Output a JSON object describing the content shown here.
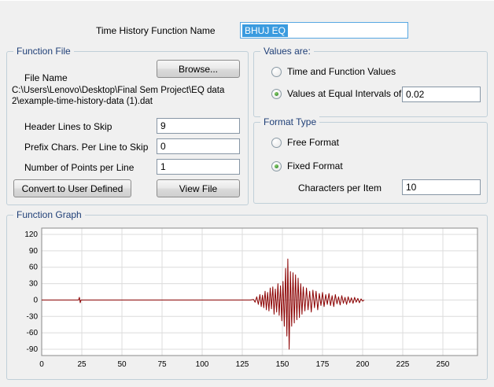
{
  "header": {
    "name_label": "Time History Function Name",
    "name_value": "BHUJ EQ"
  },
  "colors": {
    "selection": "#3a9bdf",
    "group_title": "#1f3f77"
  },
  "function_file": {
    "title": "Function File",
    "file_name_label": "File Name",
    "browse_button": "Browse...",
    "file_path_line1": "C:\\Users\\Lenovo\\Desktop\\Final Sem Project\\EQ data",
    "file_path_line2": "2\\example-time-history-data (1).dat",
    "header_lines_label": "Header Lines to Skip",
    "header_lines_value": "9",
    "prefix_chars_label": "Prefix Chars. Per Line to Skip",
    "prefix_chars_value": "0",
    "points_per_line_label": "Number of Points per Line",
    "points_per_line_value": "1",
    "convert_button": "Convert to User Defined",
    "view_file_button": "View File"
  },
  "values_are": {
    "title": "Values are:",
    "option1": "Time and Function Values",
    "option2": "Values at Equal Intervals of",
    "interval_value": "0.02",
    "selected": "Values at Equal Intervals of"
  },
  "format_type": {
    "title": "Format Type",
    "option1": "Free Format",
    "option2": "Fixed Format",
    "chars_per_item_label": "Characters per Item",
    "chars_per_item_value": "10",
    "selected": "Fixed Format"
  },
  "function_graph": {
    "title": "Function Graph"
  },
  "chart_data": {
    "type": "line",
    "title": "",
    "xlabel": "",
    "ylabel": "",
    "xlim": [
      0,
      250
    ],
    "ylim": [
      -90,
      120
    ],
    "x_ticks": [
      0,
      25,
      50,
      75,
      100,
      125,
      150,
      175,
      200,
      225,
      250
    ],
    "y_ticks": [
      120,
      90,
      60,
      30,
      0,
      -30,
      -60,
      -90
    ],
    "grid": true,
    "line_color": "#8b0000",
    "points": [
      [
        0,
        0
      ],
      [
        10,
        0
      ],
      [
        20,
        0
      ],
      [
        23,
        0
      ],
      [
        23.5,
        5
      ],
      [
        24,
        -5
      ],
      [
        24.5,
        0
      ],
      [
        40,
        0
      ],
      [
        60,
        0
      ],
      [
        80,
        0
      ],
      [
        100,
        0
      ],
      [
        120,
        0
      ],
      [
        130,
        0
      ],
      [
        132,
        1
      ],
      [
        133,
        -4
      ],
      [
        134,
        6
      ],
      [
        135,
        -8
      ],
      [
        136,
        10
      ],
      [
        136.8,
        -12
      ],
      [
        137.6,
        9
      ],
      [
        138.4,
        -14
      ],
      [
        139.2,
        16
      ],
      [
        140,
        -18
      ],
      [
        140.8,
        14
      ],
      [
        141.6,
        -20
      ],
      [
        142.4,
        22
      ],
      [
        143.2,
        -16
      ],
      [
        144,
        24
      ],
      [
        144.8,
        -26
      ],
      [
        145.6,
        20
      ],
      [
        146.4,
        -22
      ],
      [
        147.2,
        30
      ],
      [
        148,
        -28
      ],
      [
        148.8,
        26
      ],
      [
        149.6,
        -38
      ],
      [
        150.4,
        34
      ],
      [
        151.2,
        -48
      ],
      [
        152,
        58
      ],
      [
        152.8,
        -66
      ],
      [
        153.4,
        75
      ],
      [
        154.2,
        -90
      ],
      [
        155,
        52
      ],
      [
        155.8,
        -48
      ],
      [
        156.6,
        50
      ],
      [
        157.4,
        -42
      ],
      [
        158.2,
        46
      ],
      [
        159,
        -36
      ],
      [
        159.8,
        40
      ],
      [
        160.6,
        -32
      ],
      [
        161.4,
        30
      ],
      [
        162.2,
        -26
      ],
      [
        163,
        24
      ],
      [
        164,
        -20
      ],
      [
        165,
        22
      ],
      [
        166,
        -18
      ],
      [
        167,
        16
      ],
      [
        168,
        -22
      ],
      [
        169,
        18
      ],
      [
        170,
        -14
      ],
      [
        171,
        16
      ],
      [
        172,
        -18
      ],
      [
        173,
        12
      ],
      [
        174,
        -10
      ],
      [
        175,
        14
      ],
      [
        176,
        -12
      ],
      [
        177,
        10
      ],
      [
        178,
        -8
      ],
      [
        179,
        12
      ],
      [
        180,
        -10
      ],
      [
        181,
        8
      ],
      [
        182,
        -12
      ],
      [
        183,
        10
      ],
      [
        184,
        -7
      ],
      [
        185,
        6
      ],
      [
        186,
        -9
      ],
      [
        187,
        8
      ],
      [
        188,
        -6
      ],
      [
        189,
        5
      ],
      [
        190,
        -8
      ],
      [
        191,
        6
      ],
      [
        192,
        -5
      ],
      [
        193,
        4
      ],
      [
        194,
        -6
      ],
      [
        195,
        5
      ],
      [
        196,
        -4
      ],
      [
        197,
        3
      ],
      [
        198,
        -5
      ],
      [
        199,
        2
      ],
      [
        200,
        -2
      ],
      [
        201,
        0
      ]
    ]
  }
}
